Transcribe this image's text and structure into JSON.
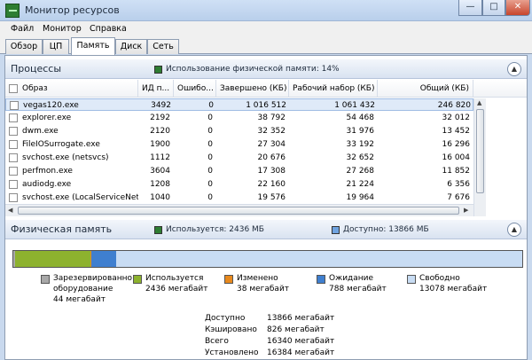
{
  "window": {
    "title": "Монитор ресурсов"
  },
  "menu": [
    "Файл",
    "Монитор",
    "Справка"
  ],
  "tabs": [
    "Обзор",
    "ЦП",
    "Память",
    "Диск",
    "Сеть"
  ],
  "processes": {
    "title": "Процессы",
    "usage_text": "Использование физической памяти: 14%",
    "columns": [
      "Образ",
      "ИД п...",
      "Ошибо...",
      "Завершено (КБ)",
      "Рабочий набор (КБ)",
      "Общий (КБ)"
    ],
    "rows": [
      {
        "image": "vegas120.exe",
        "pid": "3492",
        "faults": "0",
        "commit": "1 016 512",
        "working_set": "1 061 432",
        "shareable": "246 820"
      },
      {
        "image": "explorer.exe",
        "pid": "2192",
        "faults": "0",
        "commit": "38 792",
        "working_set": "54 468",
        "shareable": "32 012"
      },
      {
        "image": "dwm.exe",
        "pid": "2120",
        "faults": "0",
        "commit": "32 352",
        "working_set": "31 976",
        "shareable": "13 452"
      },
      {
        "image": "FileIOSurrogate.exe",
        "pid": "1900",
        "faults": "0",
        "commit": "27 304",
        "working_set": "33 192",
        "shareable": "16 296"
      },
      {
        "image": "svchost.exe (netsvcs)",
        "pid": "1112",
        "faults": "0",
        "commit": "20 676",
        "working_set": "32 652",
        "shareable": "16 004"
      },
      {
        "image": "perfmon.exe",
        "pid": "3604",
        "faults": "0",
        "commit": "17 308",
        "working_set": "27 268",
        "shareable": "11 852"
      },
      {
        "image": "audiodg.exe",
        "pid": "1208",
        "faults": "0",
        "commit": "22 160",
        "working_set": "21 224",
        "shareable": "6 356"
      },
      {
        "image": "svchost.exe (LocalServiceNet...",
        "pid": "1040",
        "faults": "0",
        "commit": "19 576",
        "working_set": "19 964",
        "shareable": "7 676"
      }
    ]
  },
  "physical_memory": {
    "title": "Физическая память",
    "in_use_text": "Используется: 2436 МБ",
    "available_text": "Доступно: 13866 МБ",
    "colors": {
      "in_use": "#8db22e",
      "modified": "#e8891d",
      "standby": "#3f7fcf",
      "free": "#c8dcf3",
      "reserved": "#a8a8a8"
    },
    "bar_fractions": {
      "reserved": 0.0027,
      "in_use": 0.1487,
      "modified": 0.0023,
      "standby": 0.0481,
      "free": 0.7982
    },
    "legend": [
      {
        "name": "Зарезервированное оборудование",
        "line1": "Зарезервированно",
        "line2": "оборудование",
        "value": "44 мегабайт"
      },
      {
        "name": "Используется",
        "value": "2436 мегабайт"
      },
      {
        "name": "Изменено",
        "value": "38 мегабайт"
      },
      {
        "name": "Ожидание",
        "value": "788 мегабайт"
      },
      {
        "name": "Свободно",
        "value": "13078 мегабайт"
      }
    ],
    "stats": [
      {
        "label": "Доступно",
        "value": "13866 мегабайт"
      },
      {
        "label": "Кэшировано",
        "value": "826 мегабайт"
      },
      {
        "label": "Всего",
        "value": "16340 мегабайт"
      },
      {
        "label": "Установлено",
        "value": "16384 мегабайт"
      }
    ]
  }
}
